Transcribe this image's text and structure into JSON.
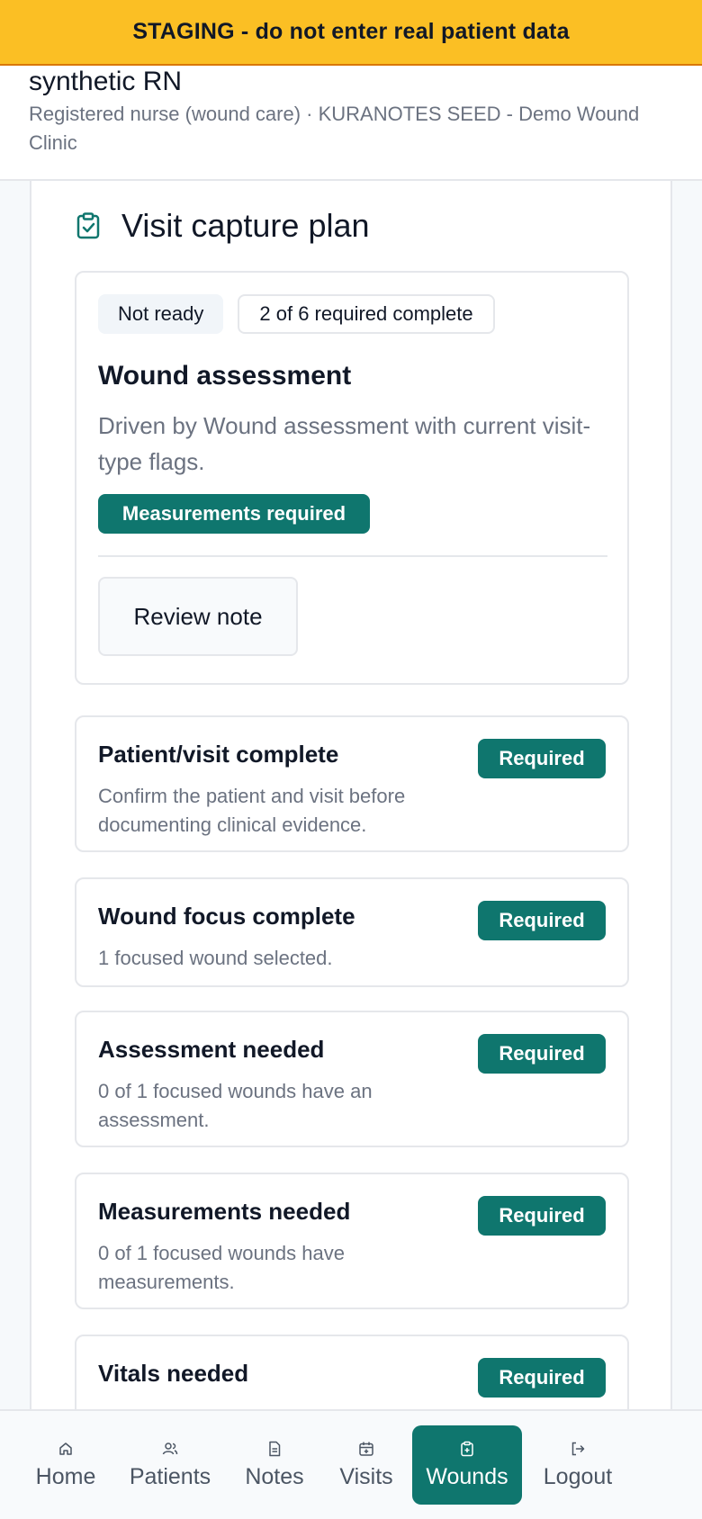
{
  "banner": {
    "text": "STAGING - do not enter real patient data"
  },
  "user": {
    "name": "synthetic RN",
    "meta": "Registered nurse (wound care) · KURANOTES SEED - Demo Wound Clinic"
  },
  "panel": {
    "title": "Visit capture plan",
    "icon": "clipboard-check-icon"
  },
  "summary": {
    "status_chip": "Not ready",
    "progress_chip": "2 of 6 required complete",
    "heading": "Wound assessment",
    "description": "Driven by Wound assessment with current visit-type flags.",
    "tag": "Measurements required",
    "review_button": "Review note"
  },
  "checklist": [
    {
      "title": "Patient/visit complete",
      "description": "Confirm the patient and visit before documenting clinical evidence.",
      "tag": "Required"
    },
    {
      "title": "Wound focus complete",
      "description": "1 focused wound selected.",
      "tag": "Required"
    },
    {
      "title": "Assessment needed",
      "description": "0 of 1 focused wounds have an assessment.",
      "tag": "Required"
    },
    {
      "title": "Measurements needed",
      "description": "0 of 1 focused wounds have measurements.",
      "tag": "Required"
    },
    {
      "title": "Vitals needed",
      "description": "",
      "tag": "Required"
    }
  ],
  "nav": [
    {
      "label": "Home",
      "icon": "home-icon",
      "active": false
    },
    {
      "label": "Patients",
      "icon": "users-icon",
      "active": false
    },
    {
      "label": "Notes",
      "icon": "document-icon",
      "active": false
    },
    {
      "label": "Visits",
      "icon": "calendar-plus-icon",
      "active": false
    },
    {
      "label": "Wounds",
      "icon": "clipboard-plus-icon",
      "active": true
    },
    {
      "label": "Logout",
      "icon": "logout-icon",
      "active": false
    }
  ],
  "colors": {
    "banner": "#fbbf24",
    "accent": "#0f766e",
    "muted_text": "#6b7280"
  }
}
